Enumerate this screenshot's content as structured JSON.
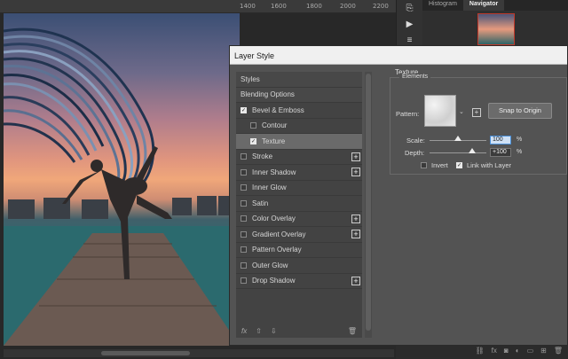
{
  "ruler": {
    "ticks": [
      "1400",
      "1600",
      "1800",
      "2000",
      "2200"
    ]
  },
  "right_panel": {
    "tabs": [
      "Histogram",
      "Navigator"
    ]
  },
  "dialog": {
    "title": "Layer Style",
    "list": [
      {
        "label": "Styles",
        "header": true
      },
      {
        "label": "Blending Options",
        "header": true
      },
      {
        "label": "Bevel & Emboss",
        "checked": true
      },
      {
        "label": "Contour",
        "checked": false,
        "indent": true
      },
      {
        "label": "Texture",
        "checked": true,
        "indent": true,
        "selected": true
      },
      {
        "label": "Stroke",
        "checked": false,
        "plus": true
      },
      {
        "label": "Inner Shadow",
        "checked": false,
        "plus": true
      },
      {
        "label": "Inner Glow",
        "checked": false
      },
      {
        "label": "Satin",
        "checked": false
      },
      {
        "label": "Color Overlay",
        "checked": false,
        "plus": true
      },
      {
        "label": "Gradient Overlay",
        "checked": false,
        "plus": true
      },
      {
        "label": "Pattern Overlay",
        "checked": false
      },
      {
        "label": "Outer Glow",
        "checked": false
      },
      {
        "label": "Drop Shadow",
        "checked": false,
        "plus": true
      }
    ],
    "footer": {
      "fx": "fx",
      "up": "⇧",
      "down": "⇩",
      "trash": "🗑"
    },
    "texture": {
      "section_title": "Texture",
      "group_title": "Elements",
      "pattern_label": "Pattern:",
      "snap_button": "Snap to Origin",
      "scale_label": "Scale:",
      "scale_value": "100",
      "depth_label": "Depth:",
      "depth_value": "+100",
      "percent": "%",
      "invert_label": "Invert",
      "invert_checked": false,
      "link_label": "Link with Layer",
      "link_checked": true,
      "scale_level": 0.5,
      "depth_level": 0.75
    }
  }
}
